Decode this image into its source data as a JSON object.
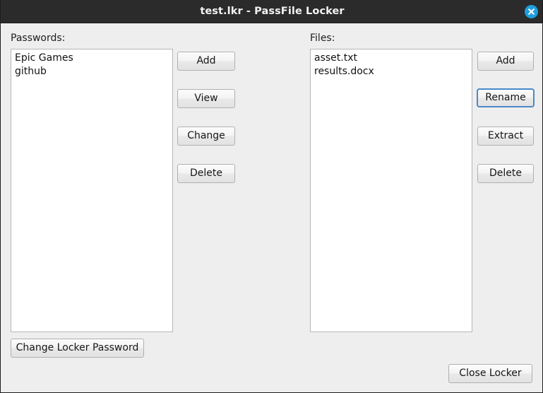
{
  "window": {
    "title": "test.lkr - PassFile Locker",
    "close_icon": "close-icon",
    "accent_color": "#1f9ede",
    "focus_color": "#4a89c8",
    "titlebar_color": "#2b2b2b",
    "background_color": "#eeeeee"
  },
  "passwords_panel": {
    "label": "Passwords:",
    "items": [
      "Epic Games",
      "github"
    ],
    "buttons": [
      {
        "label": "Add"
      },
      {
        "label": "View"
      },
      {
        "label": "Change"
      },
      {
        "label": "Delete"
      }
    ]
  },
  "files_panel": {
    "label": "Files:",
    "items": [
      "asset.txt",
      "results.docx"
    ],
    "buttons": [
      {
        "label": "Add"
      },
      {
        "label": "Rename"
      },
      {
        "label": "Extract"
      },
      {
        "label": "Delete"
      }
    ]
  },
  "footer": {
    "change_locker_password_label": "Change Locker Password",
    "close_locker_label": "Close Locker"
  }
}
